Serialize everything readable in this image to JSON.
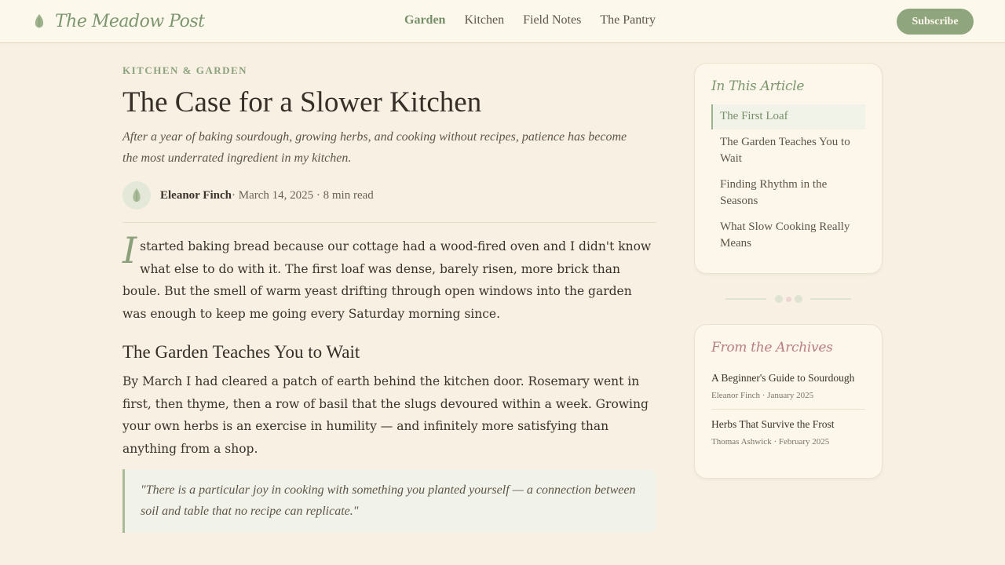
{
  "header": {
    "brand": "The Meadow Post",
    "nav": [
      {
        "label": "Garden",
        "active": true
      },
      {
        "label": "Kitchen",
        "active": false
      },
      {
        "label": "Field Notes",
        "active": false
      },
      {
        "label": "The Pantry",
        "active": false
      }
    ],
    "subscribe_label": "Subscribe"
  },
  "article": {
    "category": "KITCHEN & GARDEN",
    "title": "The Case for a Slower Kitchen",
    "subtitle": "After a year of baking sourdough, growing herbs, and cooking without recipes, patience has become the most underrated ingredient in my kitchen.",
    "author": "Eleanor Finch",
    "meta": " · March 14, 2025 · 8 min read",
    "dropcap": "I",
    "paragraph1": "started baking bread because our cottage had a wood-fired oven and I didn't know what else to do with it. The first loaf was dense, barely risen, more brick than boule. But the smell of warm yeast drifting through open windows into the garden was enough to keep me going every Saturday morning since.",
    "heading2": "The Garden Teaches You to Wait",
    "paragraph2": "By March I had cleared a patch of earth behind the kitchen door. Rosemary went in first, then thyme, then a row of basil that the slugs devoured within a week. Growing your own herbs is an exercise in humility — and infinitely more satisfying than anything from a shop.",
    "quote": "\"There is a particular joy in cooking with something you planted yourself — a connection between soil and table that no recipe can replicate.\""
  },
  "sidebar": {
    "toc_title": "In This Article",
    "toc": [
      {
        "label": "The First Loaf",
        "active": true
      },
      {
        "label": "The Garden Teaches You to Wait",
        "active": false
      },
      {
        "label": "Finding Rhythm in the Seasons",
        "active": false
      },
      {
        "label": "What Slow Cooking Really Means",
        "active": false
      }
    ],
    "archive_title": "From the Archives",
    "archive": [
      {
        "title": "A Beginner's Guide to Sourdough",
        "meta": "Eleanor Finch · January 2025"
      },
      {
        "title": "Herbs That Survive the Frost",
        "meta": "Thomas Ashwick · February 2025"
      }
    ]
  },
  "colors": {
    "background": "#f8f1e3",
    "accent_green": "#8fa57e",
    "accent_rose": "#b87c82",
    "text": "#3a332b"
  },
  "icons": {
    "brand": "leaf-icon",
    "avatar": "leaf-icon"
  }
}
